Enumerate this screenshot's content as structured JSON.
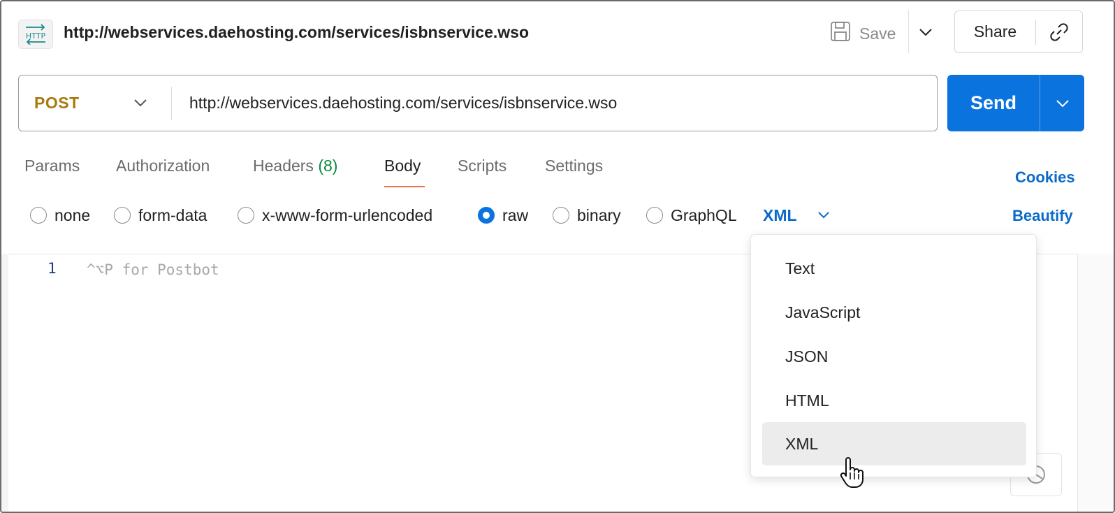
{
  "header": {
    "title": "http://webservices.daehosting.com/services/isbnservice.wso",
    "save_label": "Save",
    "share_label": "Share",
    "http_icon": "http-request-icon"
  },
  "request": {
    "method": "POST",
    "url": "http://webservices.daehosting.com/services/isbnservice.wso",
    "send_label": "Send",
    "send_color": "#0b73de",
    "method_color": "#a8790c"
  },
  "tabs": [
    {
      "label": "Params"
    },
    {
      "label": "Authorization"
    },
    {
      "label": "Headers ",
      "count": "(8)"
    },
    {
      "label": "Body",
      "active": true
    },
    {
      "label": "Scripts"
    },
    {
      "label": "Settings"
    }
  ],
  "cookies_label": "Cookies",
  "body_types": [
    {
      "label": "none",
      "checked": false
    },
    {
      "label": "form-data",
      "checked": false
    },
    {
      "label": "x-www-form-urlencoded",
      "checked": false
    },
    {
      "label": "raw",
      "checked": true
    },
    {
      "label": "binary",
      "checked": false
    },
    {
      "label": "GraphQL",
      "checked": false
    }
  ],
  "raw_type": "XML",
  "beautify_label": "Beautify",
  "editor": {
    "line_number": "1",
    "placeholder": "^⌥P for Postbot"
  },
  "dropdown": {
    "options": [
      "Text",
      "JavaScript",
      "JSON",
      "HTML",
      "XML"
    ],
    "hovered": "XML"
  }
}
